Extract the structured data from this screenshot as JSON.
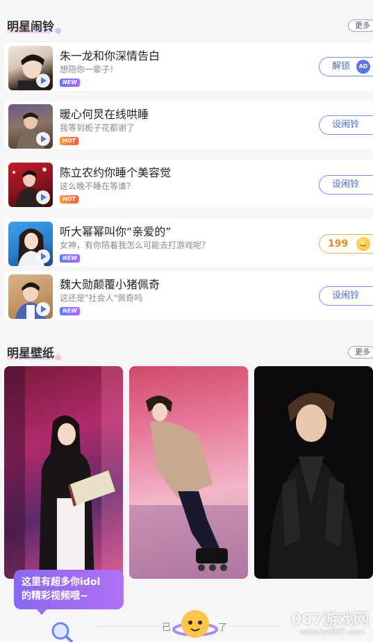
{
  "alarm_section": {
    "title": "明星闹铃",
    "more": "更多"
  },
  "ringtones": [
    {
      "title": "朱一龙和你深情告白",
      "subtitle": "想陪你一辈子！",
      "badge": "NEW",
      "button": "解锁",
      "button_extra": "AD"
    },
    {
      "title": "暖心何炅在线哄睡",
      "subtitle": "我等到栀子花都谢了",
      "badge": "HOT",
      "button": "设闹铃"
    },
    {
      "title": "陈立农约你睡个美容觉",
      "subtitle": "这么晚不睡在等谁？",
      "badge": "HOT",
      "button": "设闹铃"
    },
    {
      "title": "听大幂幂叫你“亲爱的”",
      "subtitle": "女神，有你陪着我怎么可能去打游戏呢？",
      "badge": "NEW",
      "button": "199"
    },
    {
      "title": "魏大勋颠覆小猪佩奇",
      "subtitle": "这还是\"社会人\"佩奇吗",
      "badge": "NEW",
      "button": "设闹铃"
    }
  ],
  "wallpaper_section": {
    "title": "明星壁纸",
    "more": "更多"
  },
  "tooltip": {
    "line1": "这里有超多你idol",
    "line2": "的精彩视频哦~"
  },
  "bottom": {
    "left_text": "已",
    "right_text": "了"
  },
  "watermark": {
    "main": "007游戏网",
    "sub": "www.lyx007.com"
  },
  "colors": {
    "accent": "#4a6ad8",
    "badge_new": "#5f7bff",
    "badge_hot": "#ff6a3c",
    "coin": "#e98a2a"
  }
}
